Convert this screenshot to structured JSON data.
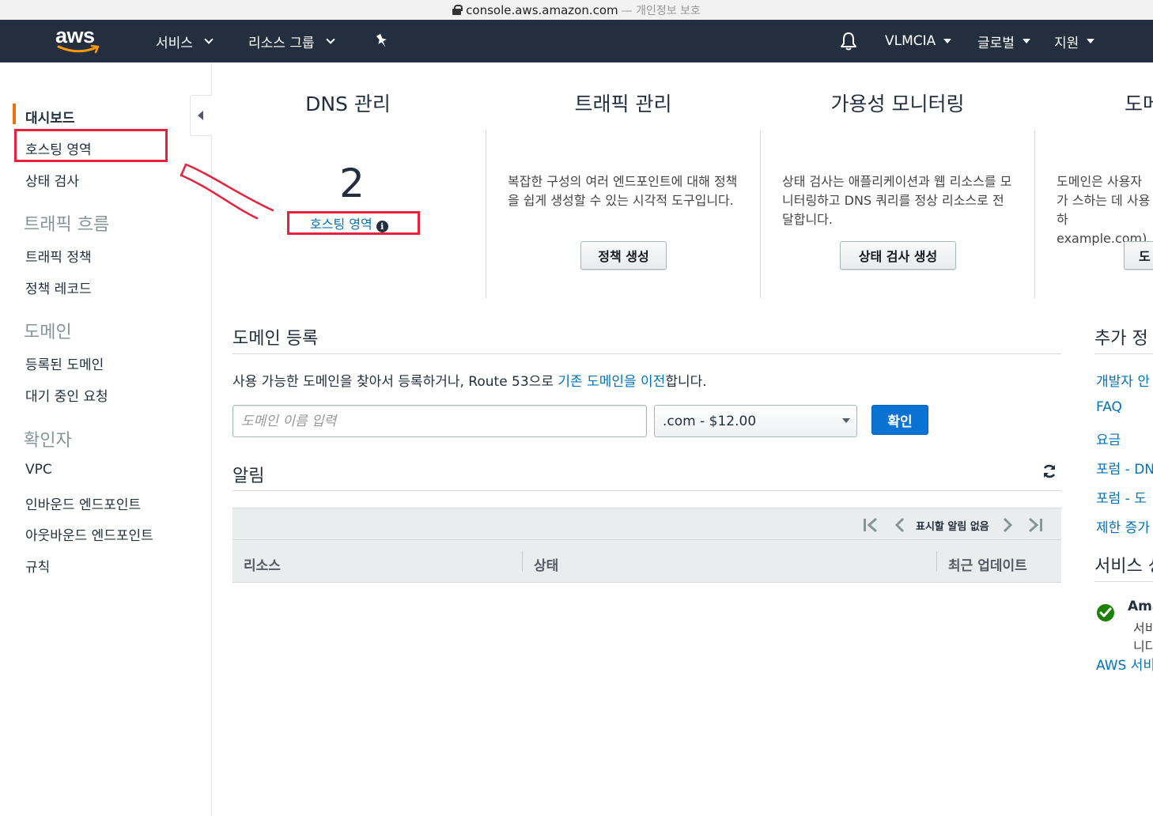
{
  "browser": {
    "url": "console.aws.amazon.com",
    "privacy": "— 개인정보 보호"
  },
  "topnav": {
    "logo": "aws",
    "services": "서비스",
    "resource_groups": "리소스 그룹",
    "account": "VLMCIA",
    "region": "글로벌",
    "support": "지원"
  },
  "sidebar": {
    "dashboard": "대시보드",
    "hosted_zones": "호스팅 영역",
    "health_checks": "상태 검사",
    "traffic_flow_head": "트래픽 흐름",
    "traffic_policies": "트래픽 정책",
    "policy_records": "정책 레코드",
    "domains_head": "도메인",
    "registered_domains": "등록된 도메인",
    "pending_requests": "대기 중인 요청",
    "resolver_head": "확인자",
    "vpc": "VPC",
    "inbound_endpoints": "인바운드 엔드포인트",
    "outbound_endpoints": "아웃바운드 엔드포인트",
    "rules": "규칙"
  },
  "columns": {
    "dns": {
      "title": "DNS 관리",
      "count": "2",
      "link": "호스팅 영역"
    },
    "traffic": {
      "title": "트래픽 관리",
      "desc": "복잡한 구성의 여러 엔드포인트에 대해 정책을 쉽게 생성할 수 있는 시각적 도구입니다.",
      "button": "정책 생성"
    },
    "availability": {
      "title": "가용성 모니터링",
      "desc": "상태 검사는 애플리케이션과 웹 리소스를 모니터링하고 DNS 쿼리를 정상 리소스로 전달합니다.",
      "button": "상태 검사 생성"
    },
    "domain": {
      "title": "도메",
      "desc": "도메인은 사용자가 스하는 데 사용하 example.com).",
      "button": "도"
    }
  },
  "register": {
    "title": "도메인 등록",
    "desc_before": "사용 가능한 도메인을 찾아서 등록하거나, Route 53으로 ",
    "desc_link": "기존 도메인을 이전",
    "desc_after": "합니다.",
    "input_placeholder": "도메인 이름 입력",
    "tld": ".com - $12.00",
    "button": "확인"
  },
  "alerts": {
    "title": "알림",
    "pager": "표시할 알림 없음",
    "col_resource": "리소스",
    "col_status": "상태",
    "col_updated": "최근 업데이트"
  },
  "right_panel": {
    "extra_title": "추가 정",
    "links": [
      "개발자 안",
      "FAQ",
      "요금",
      "포럼 - DN",
      "포럼 - 도",
      "제한 증가"
    ],
    "service_title": "서비스 성",
    "status_name": "Ama",
    "status_line1": "서비",
    "status_line2": "니다",
    "aws_link": "AWS 서비"
  },
  "colors": {
    "nav_bg": "#232f3e",
    "accent": "#ec7211",
    "link": "#0073bb",
    "primary": "#0972d3",
    "highlight": "#e8203b",
    "ok": "#1d8102"
  }
}
